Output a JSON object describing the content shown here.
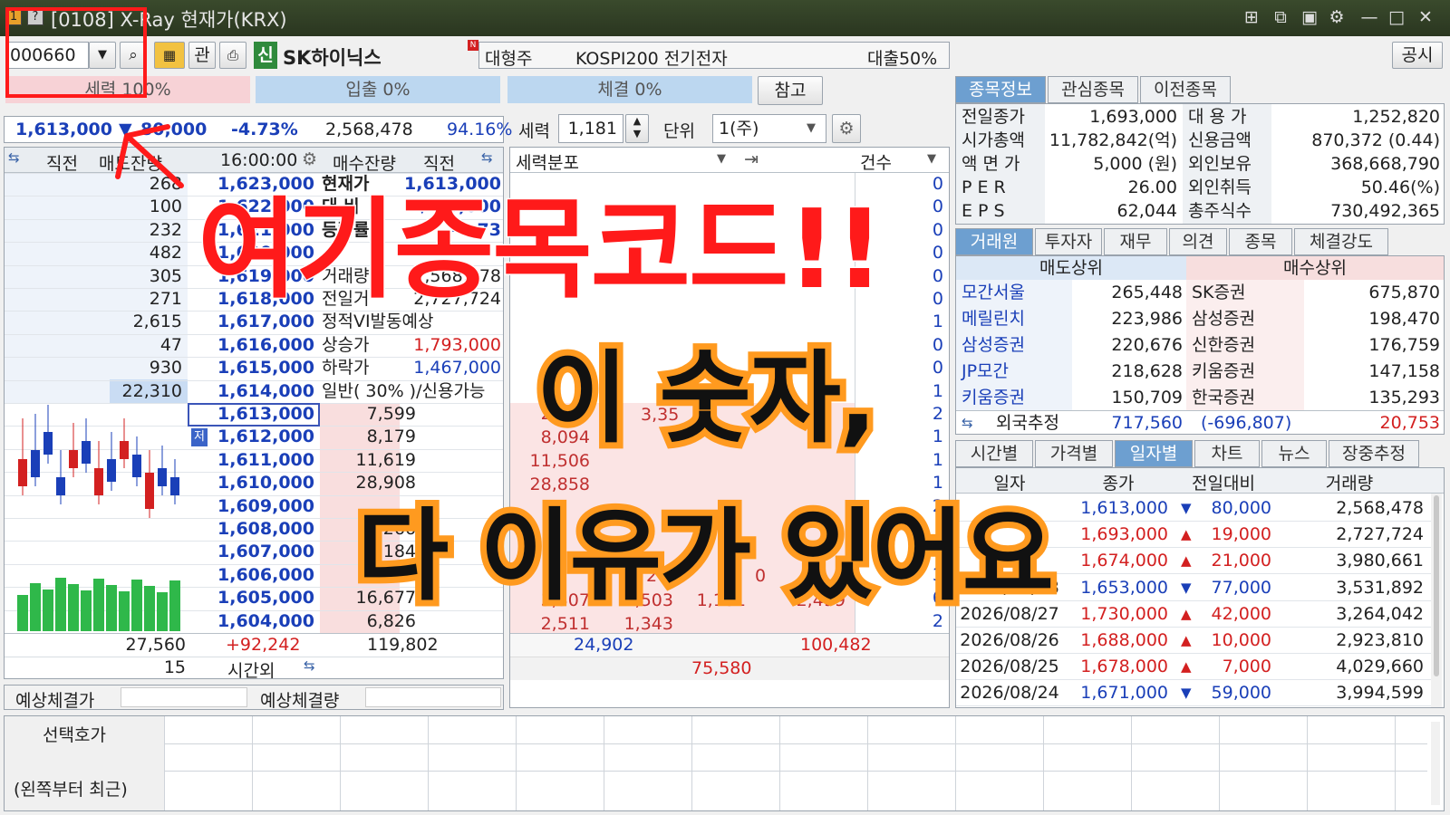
{
  "window": {
    "title": "[0108] X-Ray 현재가(KRX)"
  },
  "toolbar": {
    "code": "000660",
    "btn_gwan": "관",
    "sin": "신",
    "stock_name": "SK하이닉스",
    "n_badge": "N",
    "cat1": "대형주",
    "cat2": "KOSPI200 전기전자",
    "loan": "대출50%",
    "disclosure": "공시"
  },
  "bars": {
    "force": "세력 100%",
    "in": "입출 0%",
    "exec": "체결 0%",
    "ref": "참고"
  },
  "priceinfo": {
    "price": "1,613,000",
    "arrow": "▼",
    "change": "80,000",
    "pct": "-4.73%",
    "volume": "2,568,478",
    "ratio": "94.16%"
  },
  "controls": {
    "force_label": "세력",
    "force_val": "1,181",
    "unit_label": "단위",
    "unit_val": "1(주)",
    "dist": "세력분포",
    "count": "건수"
  },
  "ob_header": {
    "prev": "직전",
    "ask_rem": "매도잔량",
    "time": "16:00:00",
    "bid_rem": "매수잔량",
    "prev2": "직전"
  },
  "asks": [
    {
      "qty": "268",
      "price": "1,623,000"
    },
    {
      "qty": "100",
      "price": "1,622,000"
    },
    {
      "qty": "232",
      "price": "1,621,000"
    },
    {
      "qty": "482",
      "price": "1,620,000"
    },
    {
      "qty": "305",
      "price": "1,619,000"
    },
    {
      "qty": "271",
      "price": "1,618,000"
    },
    {
      "qty": "2,615",
      "price": "1,617,000"
    },
    {
      "qty": "47",
      "price": "1,616,000"
    },
    {
      "qty": "930",
      "price": "1,615,000"
    },
    {
      "qty": "22,310",
      "price": "1,614,000"
    }
  ],
  "bids": [
    {
      "price": "1,613,000",
      "qty": "7,599"
    },
    {
      "price": "1,612,000",
      "qty": "8,179"
    },
    {
      "price": "1,611,000",
      "qty": "11,619"
    },
    {
      "price": "1,610,000",
      "qty": "28,908"
    },
    {
      "price": "1,609,000",
      "qty": ""
    },
    {
      "price": "1,608,000",
      "qty": "266"
    },
    {
      "price": "1,607,000",
      "qty": "184"
    },
    {
      "price": "1,606,000",
      "qty": ""
    },
    {
      "price": "1,605,000",
      "qty": "16,677"
    },
    {
      "price": "1,604,000",
      "qty": "6,826"
    }
  ],
  "bid_low_badge": "저",
  "info_block": [
    {
      "k": "현재가",
      "v": "1,613,000"
    },
    {
      "k": "대 비",
      "v": "▼ 80,000"
    },
    {
      "k": "등락률",
      "v": "-4.73"
    },
    {
      "k": "",
      "v": ""
    },
    {
      "k": "거래량",
      "v": "2,568,478"
    },
    {
      "k": "전일거",
      "v": "2,727,724"
    },
    {
      "k": "정적VI발동예상",
      "v": ""
    },
    {
      "k": "상승가",
      "v": "1,793,000"
    },
    {
      "k": "하락가",
      "v": "1,467,000"
    },
    {
      "k": "일반( 30% )/신용가능",
      "v": ""
    }
  ],
  "ob_footer": {
    "ask_total": "27,560",
    "diff": "+92,242",
    "bid_total": "119,802",
    "after_qty": "15",
    "after_label": "시간외"
  },
  "expected": {
    "price_label": "예상체결가",
    "qty_label": "예상체결량"
  },
  "dist_rows": [
    {
      "a": "2,615",
      "b": "",
      "c": "",
      "d": "",
      "n": "1"
    },
    {
      "a": "8,094",
      "b": "",
      "c": "",
      "d": "",
      "n": "1"
    },
    {
      "a": "11,506",
      "b": "",
      "c": "",
      "d": "",
      "n": "1"
    },
    {
      "a": "28,858",
      "b": "",
      "c": "",
      "d": "",
      "n": "1"
    },
    {
      "a": "3,307",
      "b": "1,503",
      "c": "1,181",
      "d": "2,499",
      "n": "6"
    },
    {
      "a": "2,511",
      "b": "1,343",
      "c": "",
      "d": "",
      "n": "2"
    }
  ],
  "dist_frag": {
    "f1": "3,35",
    "f2": "265",
    "f3": "0"
  },
  "dist_counts": [
    "0",
    "0",
    "0",
    "0",
    "0",
    "0",
    "1",
    "0",
    "0",
    "1",
    "2",
    "1",
    "1",
    "1",
    "2",
    "",
    "",
    "3",
    "6",
    "2"
  ],
  "dist_footer": {
    "left": "24,902",
    "right": "100,482",
    "mid": "75,580"
  },
  "right_tabs1": [
    "종목정보",
    "관심종목",
    "이전종목"
  ],
  "stockinfo": [
    {
      "k": "전일종가",
      "v": "1,693,000",
      "k2": "대 용 가",
      "v2": "1,252,820"
    },
    {
      "k": "시가총액",
      "v": "11,782,842(억)",
      "k2": "신용금액",
      "v2": "870,372 (0.44)"
    },
    {
      "k": "액 면 가",
      "v": "5,000 (원)",
      "k2": "외인보유",
      "v2": "368,668,790"
    },
    {
      "k": "P E R",
      "v": "26.00",
      "k2": "외인취득",
      "v2": "50.46(%)"
    },
    {
      "k": "E P S",
      "v": "62,044",
      "k2": "총주식수",
      "v2": "730,492,365"
    }
  ],
  "right_tabs2": [
    "거래원",
    "투자자",
    "재무",
    "의견",
    "종목",
    "체결강도"
  ],
  "brokers": {
    "sell_head": "매도상위",
    "buy_head": "매수상위",
    "rows": [
      {
        "s": "모간서울",
        "sv": "265,448",
        "b": "SK증권",
        "bv": "675,870"
      },
      {
        "s": "메릴린치",
        "sv": "223,986",
        "b": "삼성증권",
        "bv": "198,470"
      },
      {
        "s": "삼성증권",
        "sv": "220,676",
        "b": "신한증권",
        "bv": "176,759"
      },
      {
        "s": "JP모간",
        "sv": "218,628",
        "b": "키움증권",
        "bv": "147,158"
      },
      {
        "s": "키움증권",
        "sv": "150,709",
        "b": "한국증권",
        "bv": "135,293"
      }
    ],
    "foreign_label": "외국추정",
    "foreign_v": "717,560",
    "foreign_d": "(-696,807)",
    "foreign_b": "20,753"
  },
  "right_tabs3": [
    "시간별",
    "가격별",
    "일자별",
    "차트",
    "뉴스",
    "장중추정"
  ],
  "daily": {
    "head": [
      "일자",
      "종가",
      "전일대비",
      "거래량"
    ],
    "rows": [
      {
        "d": "",
        "c": "1,613,000",
        "a": "▼",
        "ch": "80,000",
        "v": "2,568,478",
        "up": false
      },
      {
        "d": "",
        "c": "1,693,000",
        "a": "▲",
        "ch": "19,000",
        "v": "2,727,724",
        "up": true
      },
      {
        "d": "",
        "c": "1,674,000",
        "a": "▲",
        "ch": "21,000",
        "v": "3,980,661",
        "up": true
      },
      {
        "d": "2026/08/28",
        "c": "1,653,000",
        "a": "▼",
        "ch": "77,000",
        "v": "3,531,892",
        "up": false
      },
      {
        "d": "2026/08/27",
        "c": "1,730,000",
        "a": "▲",
        "ch": "42,000",
        "v": "3,264,042",
        "up": true
      },
      {
        "d": "2026/08/26",
        "c": "1,688,000",
        "a": "▲",
        "ch": "10,000",
        "v": "2,923,810",
        "up": true
      },
      {
        "d": "2026/08/25",
        "c": "1,678,000",
        "a": "▲",
        "ch": "7,000",
        "v": "4,029,660",
        "up": true
      },
      {
        "d": "2026/08/24",
        "c": "1,671,000",
        "a": "▼",
        "ch": "59,000",
        "v": "3,994,599",
        "up": false
      }
    ]
  },
  "bottom": {
    "l1": "선택호가",
    "l2": "(왼쪽부터 최근)"
  },
  "overlay": {
    "title": "여기종목코드!!",
    "line1": "이 숫자,",
    "line2": "다 이유가 있어요"
  },
  "colors": {
    "red": "#d32020",
    "blue": "#1a3fb8",
    "tab_on": "#6d9fd0",
    "title_bar": "#2f3c24",
    "overlay_red": "#ff1a1a",
    "overlay_orange": "#ff9a1f"
  }
}
